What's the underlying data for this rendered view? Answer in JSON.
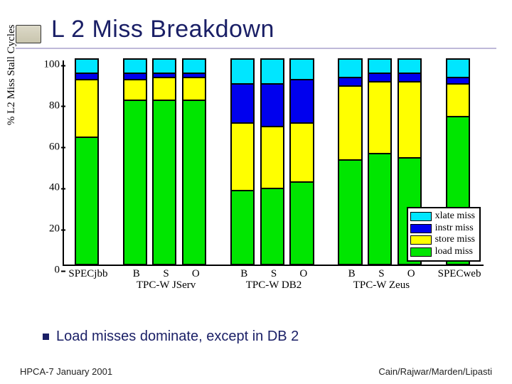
{
  "title": "L 2 Miss Breakdown",
  "bullet": "Load misses dominate, except in DB 2",
  "footer_left": "HPCA-7  January 2001",
  "footer_right": "Cain/Rajwar/Marden/Lipasti",
  "chart_data": {
    "type": "bar",
    "stacked": true,
    "ylabel": "% L2 Miss Stall Cycles",
    "xlabel": "",
    "ylim": [
      0,
      100
    ],
    "yticks": [
      0,
      20,
      40,
      60,
      80,
      100
    ],
    "categories": [
      "SPECjbb",
      "B",
      "S",
      "O",
      "B",
      "S",
      "O",
      "B",
      "S",
      "O",
      "SPECweb"
    ],
    "group_labels": [
      {
        "text": "SPECjbb",
        "cols": [
          0
        ]
      },
      {
        "text": "TPC-W JServ",
        "cols": [
          1,
          2,
          3
        ],
        "sublabels": [
          "B",
          "S",
          "O"
        ]
      },
      {
        "text": "TPC-W DB2",
        "cols": [
          4,
          5,
          6
        ],
        "sublabels": [
          "B",
          "S",
          "O"
        ]
      },
      {
        "text": "TPC-W Zeus",
        "cols": [
          7,
          8,
          9
        ],
        "sublabels": [
          "B",
          "S",
          "O"
        ]
      },
      {
        "text": "SPECweb",
        "cols": [
          10
        ]
      }
    ],
    "series": [
      {
        "name": "load miss",
        "color": "#00e600",
        "values": [
          62,
          80,
          80,
          80,
          36,
          37,
          40,
          51,
          54,
          52,
          72
        ]
      },
      {
        "name": "store miss",
        "color": "#ffff00",
        "values": [
          28,
          10,
          11,
          11,
          33,
          30,
          29,
          36,
          35,
          37,
          16
        ]
      },
      {
        "name": "instr miss",
        "color": "#0000ee",
        "values": [
          3,
          3,
          2,
          2,
          19,
          21,
          21,
          4,
          4,
          4,
          3
        ]
      },
      {
        "name": "xlate miss",
        "color": "#00e6ff",
        "values": [
          7,
          7,
          7,
          7,
          12,
          12,
          10,
          9,
          7,
          7,
          9
        ]
      }
    ],
    "legend": {
      "position": "bottom-right"
    }
  }
}
